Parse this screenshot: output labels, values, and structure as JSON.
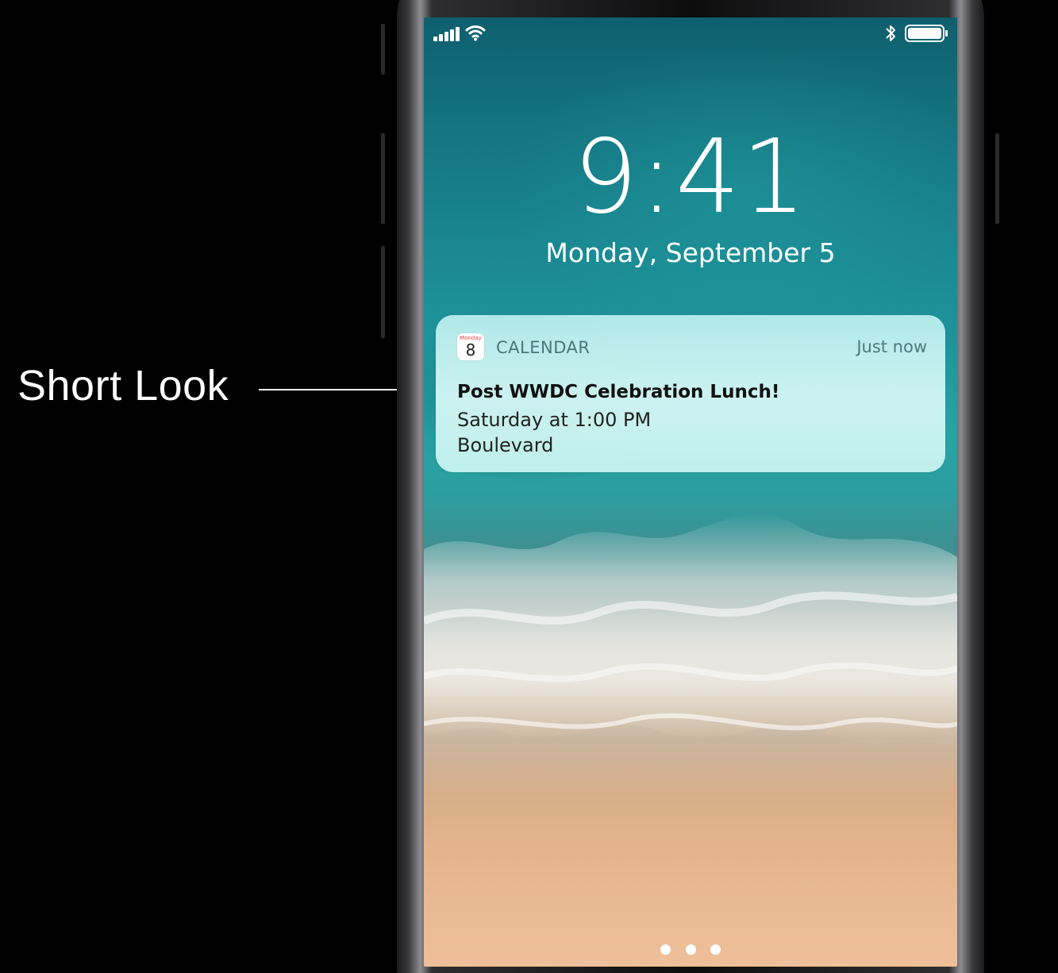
{
  "annotation": {
    "label": "Short Look"
  },
  "status_bar": {
    "signal_icon": "signal-bars-icon",
    "wifi_icon": "wifi-icon",
    "bluetooth_icon": "bluetooth-icon",
    "battery_icon": "battery-icon"
  },
  "lock_screen": {
    "time": "9:41",
    "date": "Monday, September 5"
  },
  "notification": {
    "app_icon": "calendar-icon",
    "app_icon_day": "Monday",
    "app_icon_date": "8",
    "app_name": "CALENDAR",
    "time": "Just now",
    "title": "Post WWDC Celebration Lunch!",
    "body_line_1": "Saturday at 1:00 PM",
    "body_line_2": "Boulevard"
  },
  "page_indicator": {
    "count": 3
  },
  "colors": {
    "background": "#000000",
    "annotation_text": "#ffffff",
    "notification_app_name": "#4b7679",
    "notification_title": "#111111"
  }
}
